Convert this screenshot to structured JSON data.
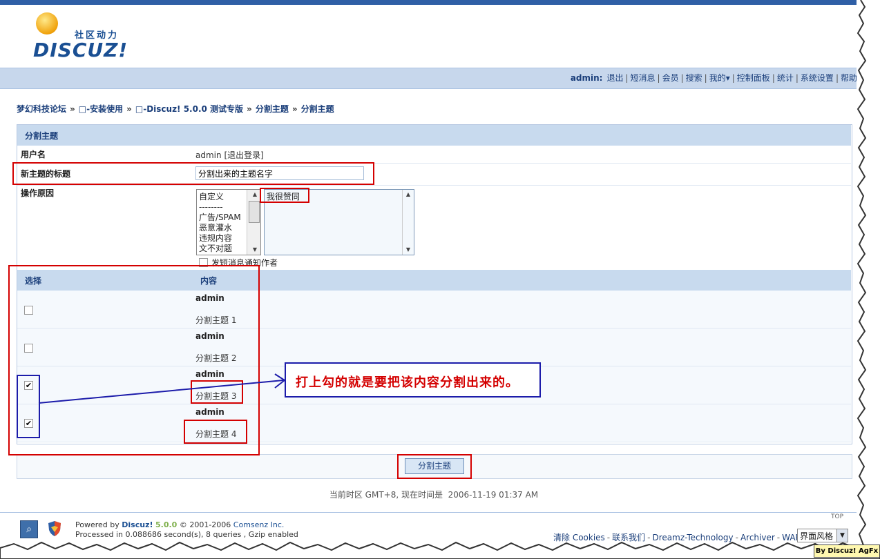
{
  "logo": {
    "cn_text": "社区动力",
    "en_text": "DISCUZ!"
  },
  "nav": {
    "user": "admin:",
    "items": [
      "退出",
      "短消息",
      "会员",
      "搜索",
      "我的▾",
      "控制面板",
      "统计",
      "系统设置",
      "帮助"
    ]
  },
  "breadcrumb": {
    "items": [
      "梦幻科技论坛",
      "□-安装使用",
      "□-Discuz! 5.0.0 测试专版",
      "分割主题",
      "分割主题"
    ],
    "separator": "»"
  },
  "panel": {
    "title": "分割主题",
    "username_label": "用户名",
    "username_value": "admin",
    "logout_link": "[退出登录]",
    "new_title_label": "新主题的标题",
    "new_title_value": "分割出来的主题名字",
    "reason_label": "操作原因",
    "reason_options": [
      "自定义",
      "--------",
      "广告/SPAM",
      "恶意灌水",
      "违规内容",
      "文不对题"
    ],
    "reason_text": "我很赞同",
    "notify_label": "发短消息通知作者",
    "notify_checked": false
  },
  "posts_table": {
    "col_select": "选择",
    "col_content": "内容",
    "rows": [
      {
        "author": "admin",
        "content": "分割主题 1",
        "checked": false
      },
      {
        "author": "admin",
        "content": "分割主题 2",
        "checked": false
      },
      {
        "author": "admin",
        "content": "分割主题 3",
        "checked": true
      },
      {
        "author": "admin",
        "content": "分割主题 4",
        "checked": true
      }
    ]
  },
  "submit_label": "分割主题",
  "timezone": {
    "label": "当前时区 GMT+8, 现在时间是",
    "time": "2006-11-19 01:37 AM"
  },
  "annotation": {
    "callout": "打上勾的就是要把该内容分割出来的。"
  },
  "footer": {
    "powered_prefix": "Powered by",
    "powered_brand": "Discuz!",
    "version": "5.0.0",
    "copyright_prefix": "© 2001-2006",
    "copyright_company": "Comsenz Inc.",
    "processed": "Processed in 0.088686 second(s), 8 queries , Gzip enabled",
    "top": "TOP",
    "links": [
      "清除 Cookies",
      "联系我们",
      "Dreamz-Technology",
      "Archiver",
      "WAP"
    ],
    "style_select": "界面风格",
    "watermark": "By Discuz! AgFx"
  },
  "colors": {
    "accent": "#1a3e7a",
    "header_band": "#c8daee",
    "annotation_red": "#d40000",
    "annotation_blue": "#1c1caa"
  }
}
